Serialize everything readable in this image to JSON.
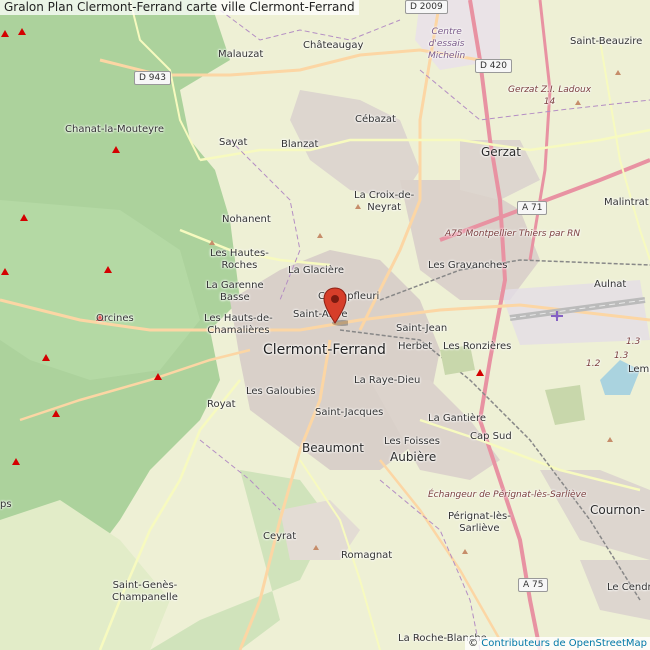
{
  "header": {
    "title": "Gralon Plan Clermont-Ferrand carte ville Clermont-Ferrand"
  },
  "attribution": {
    "prefix": "© ",
    "link": "Contributeurs de OpenStreetMap"
  },
  "roads": {
    "d2009": "D 2009",
    "d943": "D 943",
    "d420": "D 420",
    "a71": "A 71",
    "a75": "A 75"
  },
  "places": {
    "chateaugay": "Châteaugay",
    "malauzat": "Malauzat",
    "saint_beauzire": "Saint-Beauzire",
    "centre_essais": "Centre\nd'essais\nMichelin",
    "gerzat_zi": "Gerzat Z.I. Ladoux\n14",
    "cebazat": "Cébazat",
    "chanat": "Chanat-la-Mouteyre",
    "sayat": "Sayat",
    "blanzat": "Blanzat",
    "gerzat": "Gerzat",
    "croix_neyrat": "La Croix-de-\nNeyrat",
    "malintrat": "Malintrat",
    "nohanent": "Nohanent",
    "a75_montpellier": "A75 Montpellier Thiers par RN",
    "hautes_roches": "Les Hautes-\nRoches",
    "glaciere": "La Glacière",
    "gravanches": "Les Gravanches",
    "garenne": "La Garenne\nBasse",
    "champfleuri": "Champfleuri",
    "aulnat": "Aulnat",
    "orcines": "Orcines",
    "saint_alyre": "Saint-Alyre",
    "hauts_chamalieres": "Les Hauts-de-\nChamalières",
    "saint_jean": "Saint-Jean",
    "herbet": "Herbet",
    "ronzieres": "Les Ronzières",
    "clermont": "Clermont-Ferrand",
    "lemp": "Lemp",
    "raye_dieu": "La Raye-Dieu",
    "royat": "Royat",
    "galoubies": "Les Galoubies",
    "gantiere": "La Gantière",
    "saint_jacques": "Saint-Jacques",
    "cap_sud": "Cap Sud",
    "foisses": "Les Foisses",
    "beaumont": "Beaumont",
    "aubiere": "Aubière",
    "echangeur": "Échangeur de Pérignat-lès-Sarliève",
    "cournon": "Cournon-",
    "perignat": "Pérignat-lès-\nSarliève",
    "ceyrat": "Ceyrat",
    "romagnat": "Romagnat",
    "saint_genes": "Saint-Genès-\nChampanelle",
    "le_cendre": "Le Cendre",
    "roche_blanche": "La Roche-Blanche",
    "ps": "ps",
    "n12": "1.2",
    "n13a": "1.3",
    "n13b": "1.3"
  },
  "colors": {
    "forest": "#acd29c",
    "farmland": "#eef0d5",
    "urban": "#d9d0c9",
    "motorway": "#e892a2",
    "primary": "#fcd6a4",
    "secondary": "#f7fabf",
    "peak": "#d40000",
    "marker": "#d63e2a"
  },
  "icons": {
    "marker": "map-pin-icon",
    "airport": "airplane-icon",
    "peak": "peak-triangle-icon"
  }
}
